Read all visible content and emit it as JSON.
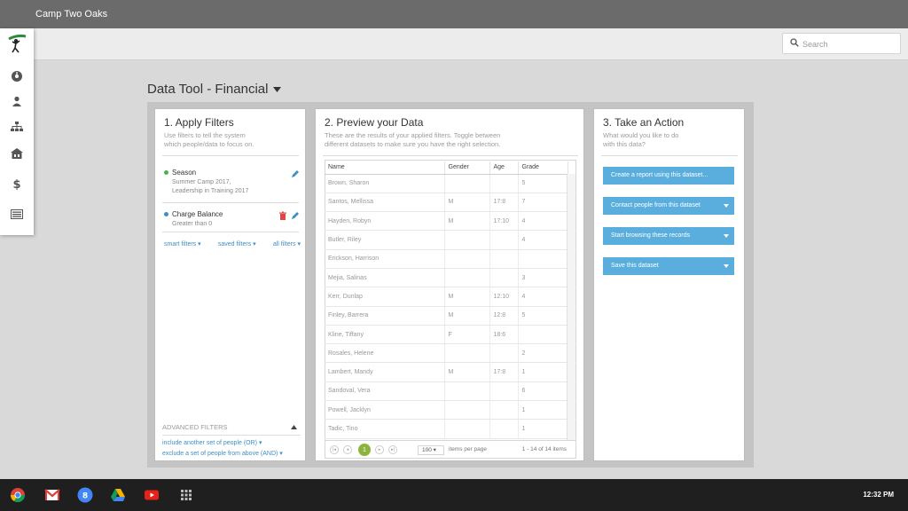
{
  "window": {
    "title": "Camp Two Oaks"
  },
  "search": {
    "placeholder": "Search"
  },
  "sidebar": {
    "icons": [
      "logo-icon",
      "dashboard-icon",
      "person-icon",
      "org-chart-icon",
      "building-icon",
      "dollar-icon",
      "list-card-icon"
    ]
  },
  "page": {
    "title": "Data Tool - Financial"
  },
  "filters": {
    "heading": "1. Apply Filters",
    "desc_line1": "Use filters to tell the system",
    "desc_line2": "which people/data to focus on.",
    "items": [
      {
        "name": "Season",
        "detail1": "Summer Camp 2017,",
        "detail2": "Leadership in Training 2017",
        "dot_color": "#4caf50"
      },
      {
        "name": "Charge Balance",
        "detail1": "Greater than 0",
        "detail2": "",
        "dot_color": "#3d8fc6"
      }
    ],
    "links": {
      "smart": "smart filters ▾",
      "saved": "saved  filters ▾",
      "all": "all filters ▾"
    },
    "advanced": {
      "label": "ADVANCED FILTERS",
      "include": "include another set of people (OR) ▾",
      "exclude": "exclude a set of people from above (AND) ▾"
    }
  },
  "preview": {
    "heading": "2. Preview your Data",
    "desc_line1": "These are the results of your applied filters. Toggle between",
    "desc_line2": "different datasets to make sure you have the right selection.",
    "columns": {
      "name": "Name",
      "gender": "Gender",
      "age": "Age",
      "grade": "Grade"
    },
    "rows": [
      {
        "name": "Brown, Sharon",
        "gender": "",
        "age": "",
        "grade": "5"
      },
      {
        "name": "Santos, Mellissa",
        "gender": "M",
        "age": "17:8",
        "grade": "7"
      },
      {
        "name": "Hayden, Robyn",
        "gender": "M",
        "age": "17:10",
        "grade": "4"
      },
      {
        "name": "Butler, Riley",
        "gender": "",
        "age": "",
        "grade": "4"
      },
      {
        "name": "Erickson, Harrison",
        "gender": "",
        "age": "",
        "grade": ""
      },
      {
        "name": "Mejia, Salinas",
        "gender": "",
        "age": "",
        "grade": "3"
      },
      {
        "name": "Kerr, Dunlap",
        "gender": "M",
        "age": "12:10",
        "grade": "4"
      },
      {
        "name": "Finley, Barrera",
        "gender": "M",
        "age": "12:8",
        "grade": "5"
      },
      {
        "name": "Kline, Tiffany",
        "gender": "F",
        "age": "18:6",
        "grade": ""
      },
      {
        "name": "Rosales, Helene",
        "gender": "",
        "age": "",
        "grade": "2"
      },
      {
        "name": "Lambert, Mandy",
        "gender": "M",
        "age": "17:8",
        "grade": "1"
      },
      {
        "name": "Sandoval, Vera",
        "gender": "",
        "age": "",
        "grade": "6"
      },
      {
        "name": "Powell, Jacklyn",
        "gender": "",
        "age": "",
        "grade": "1"
      },
      {
        "name": "Tadic, Tino",
        "gender": "",
        "age": "",
        "grade": "1"
      }
    ],
    "pager": {
      "current": "1",
      "page_size": "100",
      "per_page_label": "items per page",
      "count": "1 - 14 of 14 items"
    }
  },
  "actions": {
    "heading": "3. Take an Action",
    "desc_line1": "What would you like to do",
    "desc_line2": "with this data?",
    "buttons": [
      {
        "label": "Create a report using this dataset...",
        "dropdown": false
      },
      {
        "label": "Contact people from this dataset",
        "dropdown": true
      },
      {
        "label": "Start browsing these records",
        "dropdown": true
      },
      {
        "label": "Save this dataset",
        "dropdown": true
      }
    ]
  },
  "taskbar": {
    "apps": [
      "chrome-icon",
      "gmail-icon",
      "google-plus-icon",
      "drive-icon",
      "youtube-icon",
      "app-launcher-icon"
    ],
    "clock": "12:32 PM"
  }
}
